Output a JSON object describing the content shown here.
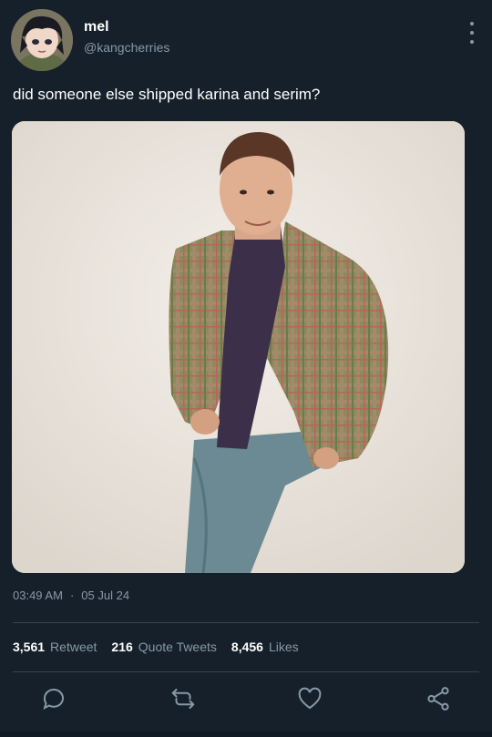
{
  "user": {
    "name": "mel",
    "handle": "@kangcherries"
  },
  "tweet": {
    "text": "did someone else shipped karina and serim?",
    "time": "03:49 AM",
    "date": "05 Jul 24"
  },
  "stats": [
    {
      "count": "3,561",
      "label": "Retweet"
    },
    {
      "count": "216",
      "label": "Quote Tweets"
    },
    {
      "count": "8,456",
      "label": "Likes"
    }
  ],
  "actions": [
    "reply-icon",
    "retweet-icon",
    "like-icon",
    "share-icon"
  ],
  "colors": {
    "background": "#15202b",
    "muted": "#8899a6",
    "divider": "#38444d"
  }
}
